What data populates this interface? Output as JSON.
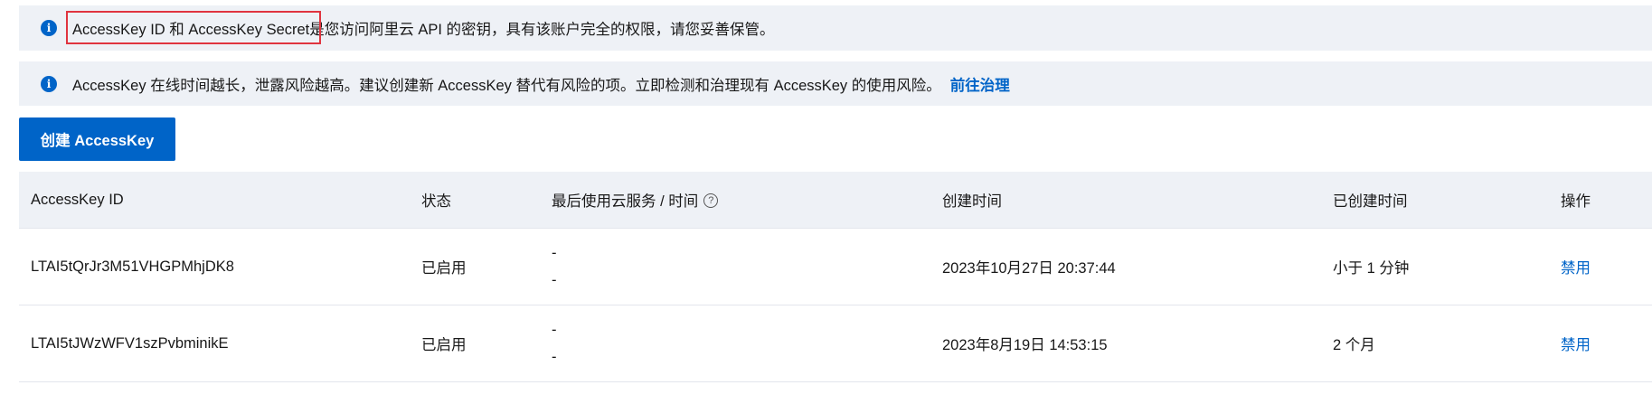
{
  "alerts": {
    "first": {
      "highlighted": "AccessKey ID 和 AccessKey Secret",
      "rest": "是您访问阿里云 API 的密钥，具有该账户完全的权限，请您妥善保管。"
    },
    "second": {
      "text": "AccessKey 在线时间越长，泄露风险越高。建议创建新 AccessKey 替代有风险的项。立即检测和治理现有 AccessKey 的使用风险。",
      "link": "前往治理"
    }
  },
  "create_button": "创建 AccessKey",
  "table": {
    "headers": {
      "id": "AccessKey ID",
      "status": "状态",
      "last_used": "最后使用云服务 / 时间",
      "created": "创建时间",
      "age": "已创建时间",
      "action": "操作"
    },
    "rows": [
      {
        "id": "LTAI5tQrJr3M51VHGPMhjDK8",
        "status": "已启用",
        "last_service": "-",
        "last_time": "-",
        "created": "2023年10月27日 20:37:44",
        "age": "小于 1 分钟",
        "action": "禁用"
      },
      {
        "id": "LTAI5tJWzWFV1szPvbminikE",
        "status": "已启用",
        "last_service": "-",
        "last_time": "-",
        "created": "2023年8月19日 14:53:15",
        "age": "2 个月",
        "action": "禁用"
      }
    ]
  },
  "colors": {
    "primary": "#0064c8",
    "alert_bg": "#eef1f6",
    "highlight_border": "#e0343f"
  }
}
